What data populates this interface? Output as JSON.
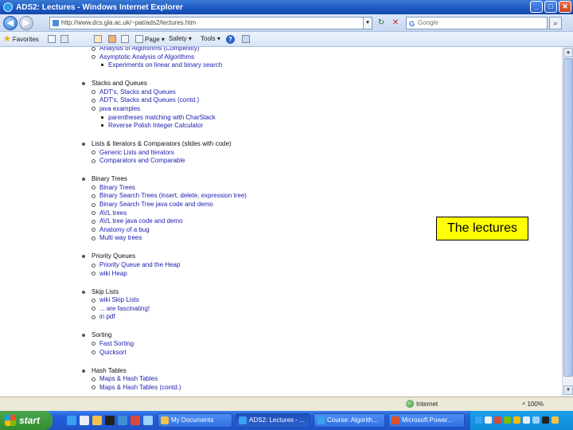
{
  "window": {
    "title": "ADS2: Lectures - Windows Internet Explorer",
    "controls": {
      "minimize": "_",
      "maximize": "□",
      "close": "✕"
    }
  },
  "address_bar": {
    "url": "http://www.dcs.gla.ac.uk/~pat/ads2/lectures.htm",
    "search_placeholder": "Google",
    "search_engine_glyph": "G",
    "refresh_glyph": "↻",
    "stop_glyph": "✕",
    "dropdown_glyph": "▾",
    "search_glyph": "⌕",
    "back_glyph": "◀",
    "forward_glyph": "▶"
  },
  "command_bar": {
    "favorites": "Favorites",
    "page": "Page ▾",
    "safety": "Safety ▾",
    "tools": "Tools ▾",
    "help": "?"
  },
  "content": {
    "sections": [
      {
        "title": "",
        "items": [
          {
            "text": "Analysis of Algorithms (Complexity)",
            "level": 1
          },
          {
            "text": "Asymptotic Analysis of Algorithms",
            "level": 1
          },
          {
            "text": "Experiments on linear and binary search",
            "level": 2
          }
        ]
      },
      {
        "title": "Stacks and Queues",
        "items": [
          {
            "text": "ADT's, Stacks and Queues",
            "level": 1
          },
          {
            "text": "ADT's, Stacks and Queues (contd.)",
            "level": 1
          },
          {
            "text": "java examples",
            "level": 1
          },
          {
            "text": "parentheses matching with CharStack",
            "level": 2
          },
          {
            "text": "Reverse Polish Integer Calculator",
            "level": 2
          }
        ]
      },
      {
        "title": "Lists & Iterators & Comparators (slides with code)",
        "items": [
          {
            "text": "Generic Lists and Iterators",
            "level": 1
          },
          {
            "text": "Comparators and Comparable",
            "level": 1
          }
        ]
      },
      {
        "title": "Binary Trees",
        "items": [
          {
            "text": "Binary Trees",
            "level": 1
          },
          {
            "text": "Binary Search Trees (insert, delete, expression tree)",
            "level": 1
          },
          {
            "text": "Binary Search Tree java code and demo",
            "level": 1
          },
          {
            "text": "AVL trees",
            "level": 1
          },
          {
            "text": "AVL tree java code and demo",
            "level": 1
          },
          {
            "text": "Anatomy of a bug",
            "level": 1
          },
          {
            "text": "Multi way trees",
            "level": 1
          }
        ]
      },
      {
        "title": "Priority Queues",
        "items": [
          {
            "text": "Priority Queue and the Heap",
            "level": 1
          },
          {
            "text": "wiki Heap",
            "level": 1
          }
        ]
      },
      {
        "title": "Skip Lists",
        "items": [
          {
            "text": "wiki Skip Lists",
            "level": 1
          },
          {
            "text": "... are fascinating!",
            "level": 1
          },
          {
            "text": "in pdf",
            "level": 1
          }
        ]
      },
      {
        "title": "Sorting",
        "items": [
          {
            "text": "Fast Sorting",
            "level": 1
          },
          {
            "text": "Quicksort",
            "level": 1
          }
        ]
      },
      {
        "title": "Hash Tables",
        "items": [
          {
            "text": "Maps & Hash Tables",
            "level": 1
          },
          {
            "text": "Maps & Hash Tables (contd.)",
            "level": 1
          }
        ]
      }
    ]
  },
  "callout": {
    "text": "The lectures"
  },
  "status_bar": {
    "zone": "Internet",
    "zoom": "100%"
  },
  "taskbar": {
    "start": "start",
    "tasks": [
      {
        "label": "My Documents",
        "active": false
      },
      {
        "label": "ADS2: Lectures - ...",
        "active": true
      },
      {
        "label": "Course: Algorith...",
        "active": false
      },
      {
        "label": "Microsoft Power...",
        "active": false
      }
    ]
  },
  "colors": {
    "link": "#1b1bb0",
    "callout_bg": "#ffff00",
    "taskbar": "#245edb",
    "start": "#2f8d2f"
  }
}
